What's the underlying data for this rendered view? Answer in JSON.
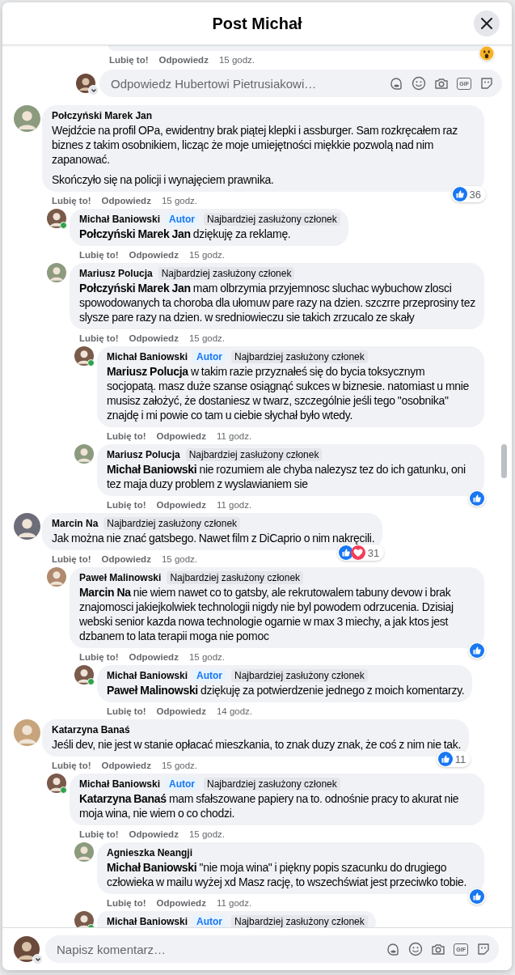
{
  "header": {
    "title": "Post Michał"
  },
  "top_fragment": {
    "like_label": "Lubię to!",
    "reply_label": "Odpowiedz",
    "time": "15 godz.",
    "reactions": [
      {
        "kind": "wow"
      }
    ]
  },
  "reply_field": {
    "placeholder": "Odpowiedz Hubertowi Pietrusiakowi…",
    "icons": [
      {
        "kind": "sticker"
      },
      {
        "kind": "emoji"
      },
      {
        "kind": "camera"
      },
      {
        "kind": "gif",
        "label": "GIF"
      },
      {
        "kind": "avatar-sticker"
      }
    ]
  },
  "comments": [
    {
      "author": "Połczyński Marek Jan",
      "online": false,
      "paragraphs": [
        "Wejdźcie na profil OPa, ewidentny brak piątej klepki i assburger. Sam rozkręcałem raz biznes z takim osobnikiem, licząc że moje umiejętności miękkie pozwolą nad nim zapanować.",
        "Skończyło się na policji i wynajęciem prawnika."
      ],
      "like_label": "Lubię to!",
      "reply_label": "Odpowiedz",
      "time": "15 godz.",
      "reactions": {
        "kinds": [
          {
            "kind": "like"
          }
        ],
        "count": "36"
      },
      "children": [
        {
          "author": "Michał Baniowski",
          "online": true,
          "badges": [
            {
              "kind": "author",
              "label": "Autor"
            },
            {
              "kind": "member",
              "label": "Najbardziej zasłużony członek"
            }
          ],
          "paragraphs": [
            "**Połczyński Marek Jan** dziękuję za reklamę."
          ],
          "like_label": "Lubię to!",
          "reply_label": "Odpowiedz",
          "time": "15 godz."
        },
        {
          "author": "Mariusz Polucja",
          "online": false,
          "badges": [
            {
              "kind": "member",
              "label": "Najbardziej zasłużony członek"
            }
          ],
          "paragraphs": [
            "**Połczyński Marek Jan** mam olbrzymia przyjemnosc sluchac wybuchow zlosci spowodowanych ta choroba dla ułomuw pare razy na dzien. szczrre przeprosiny tez slysze pare razy na dzien. w sredniowieczu sie takich zrzucalo ze skały"
          ],
          "like_label": "Lubię to!",
          "reply_label": "Odpowiedz",
          "time": "15 godz.",
          "children": [
            {
              "author": "Michał Baniowski",
              "online": true,
              "badges": [
                {
                  "kind": "author",
                  "label": "Autor"
                },
                {
                  "kind": "member",
                  "label": "Najbardziej zasłużony członek"
                }
              ],
              "paragraphs": [
                "**Mariusz Polucja** w takim razie przyznałeś się do bycia toksycznym socjopatą. masz duże szanse osiągnąć sukces w biznesie. natomiast u mnie musisz założyć, że dostaniesz w twarz, szczególnie jeśli tego \"osobnika\" znajdę i mi powie co tam u ciebie słychał było wtedy."
              ],
              "like_label": "Lubię to!",
              "reply_label": "Odpowiedz",
              "time": "11 godz."
            },
            {
              "author": "Mariusz Polucja",
              "online": false,
              "badges": [
                {
                  "kind": "member",
                  "label": "Najbardziej zasłużony członek"
                }
              ],
              "paragraphs": [
                "**Michał Baniowski** nie rozumiem ale chyba nalezysz tez do ich gatunku, oni tez maja duzy problem z wyslawianiem sie"
              ],
              "like_label": "Lubię to!",
              "reply_label": "Odpowiedz",
              "time": "11 godz.",
              "reactions": {
                "kinds": [
                  {
                    "kind": "like"
                  }
                ]
              }
            }
          ]
        }
      ]
    },
    {
      "author": "Marcin Na",
      "online": false,
      "badges": [
        {
          "kind": "member",
          "label": "Najbardziej zasłużony członek"
        }
      ],
      "paragraphs": [
        "Jak można nie znać gatsbego. Nawet film z DiCaprio o nim nakręcili."
      ],
      "like_label": "Lubię to!",
      "reply_label": "Odpowiedz",
      "time": "15 godz.",
      "reactions": {
        "kinds": [
          {
            "kind": "like"
          },
          {
            "kind": "love"
          }
        ],
        "count": "31"
      },
      "children": [
        {
          "author": "Paweł Malinowski",
          "online": false,
          "badges": [
            {
              "kind": "member",
              "label": "Najbardziej zasłużony członek"
            }
          ],
          "paragraphs": [
            "**Marcin Na** nie wiem nawet co to gatsby, ale rekrutowalem tabuny devow i brak znajomosci jakiejkolwiek technologii nigdy nie byl powodem odrzucenia. Dzisiaj webski senior kazda nowa technologie ogarnie w max 3 miechy, a jak ktos jest dzbanem to lata terapii moga nie pomoc"
          ],
          "like_label": "Lubię to!",
          "reply_label": "Odpowiedz",
          "time": "15 godz.",
          "reactions": {
            "kinds": [
              {
                "kind": "like"
              }
            ]
          },
          "children": [
            {
              "author": "Michał Baniowski",
              "online": true,
              "badges": [
                {
                  "kind": "author",
                  "label": "Autor"
                },
                {
                  "kind": "member",
                  "label": "Najbardziej zasłużony członek"
                }
              ],
              "paragraphs": [
                "**Paweł Malinowski** dziękuję za potwierdzenie jednego z moich komentarzy."
              ],
              "like_label": "Lubię to!",
              "reply_label": "Odpowiedz",
              "time": "14 godz."
            }
          ]
        }
      ]
    },
    {
      "author": "Katarzyna Banaś",
      "online": false,
      "paragraphs": [
        "Jeśli dev, nie jest w stanie opłacać mieszkania, to znak duzy znak, że coś z nim nie tak."
      ],
      "like_label": "Lubię to!",
      "reply_label": "Odpowiedz",
      "time": "15 godz.",
      "reactions": {
        "kinds": [
          {
            "kind": "like"
          }
        ],
        "count": "11"
      },
      "children": [
        {
          "author": "Michał Baniowski",
          "online": true,
          "badges": [
            {
              "kind": "author",
              "label": "Autor"
            },
            {
              "kind": "member",
              "label": "Najbardziej zasłużony członek"
            }
          ],
          "paragraphs": [
            "**Katarzyna Banaś** mam sfałszowane papiery na to. odnośnie pracy to akurat nie moja wina, nie wiem o co chodzi."
          ],
          "like_label": "Lubię to!",
          "reply_label": "Odpowiedz",
          "time": "15 godz.",
          "children": [
            {
              "author": "Agnieszka Neangji",
              "online": false,
              "paragraphs": [
                "**Michał Baniowski** \"nie moja wina\" i piękny popis szacunku do drugiego człowieka w mailu wyżej xd Masz rację, to wszechświat jest przeciwko tobie."
              ],
              "like_label": "Lubię to!",
              "reply_label": "Odpowiedz",
              "time": "11 godz.",
              "reactions": {
                "kinds": [
                  {
                    "kind": "like"
                  }
                ]
              }
            },
            {
              "author": "Michał Baniowski",
              "online": true,
              "badges": [
                {
                  "kind": "author",
                  "label": "Autor"
                },
                {
                  "kind": "member",
                  "label": "Najbardziej zasłużony członek"
                }
              ]
            }
          ]
        }
      ]
    }
  ],
  "composer": {
    "placeholder": "Napisz komentarz…",
    "icons": [
      {
        "kind": "sticker"
      },
      {
        "kind": "emoji"
      },
      {
        "kind": "camera"
      },
      {
        "kind": "gif",
        "label": "GIF"
      },
      {
        "kind": "avatar-sticker"
      }
    ]
  }
}
